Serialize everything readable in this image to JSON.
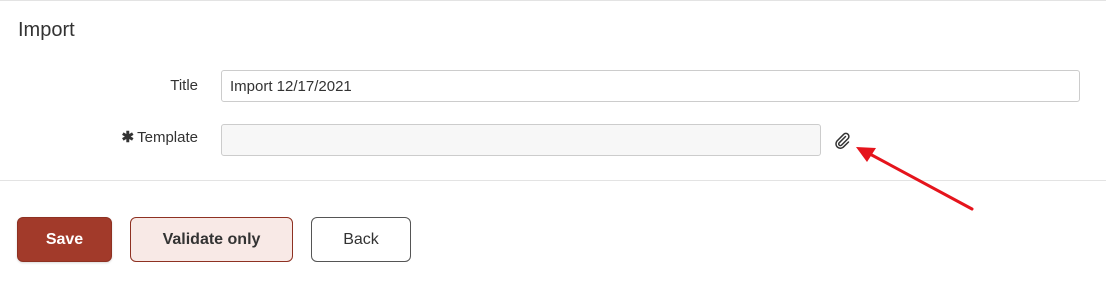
{
  "section": {
    "title": "Import"
  },
  "form": {
    "title_label": "Title",
    "title_value": "Import 12/17/2021",
    "template_required_mark": "✱",
    "template_label": "Template",
    "template_value": "",
    "attach_icon": "paperclip-icon"
  },
  "actions": {
    "save_label": "Save",
    "validate_label": "Validate only",
    "back_label": "Back"
  },
  "colors": {
    "primary": "#a23a2a",
    "secondary_bg": "#f8e9e6",
    "annotation": "#e5141c"
  }
}
